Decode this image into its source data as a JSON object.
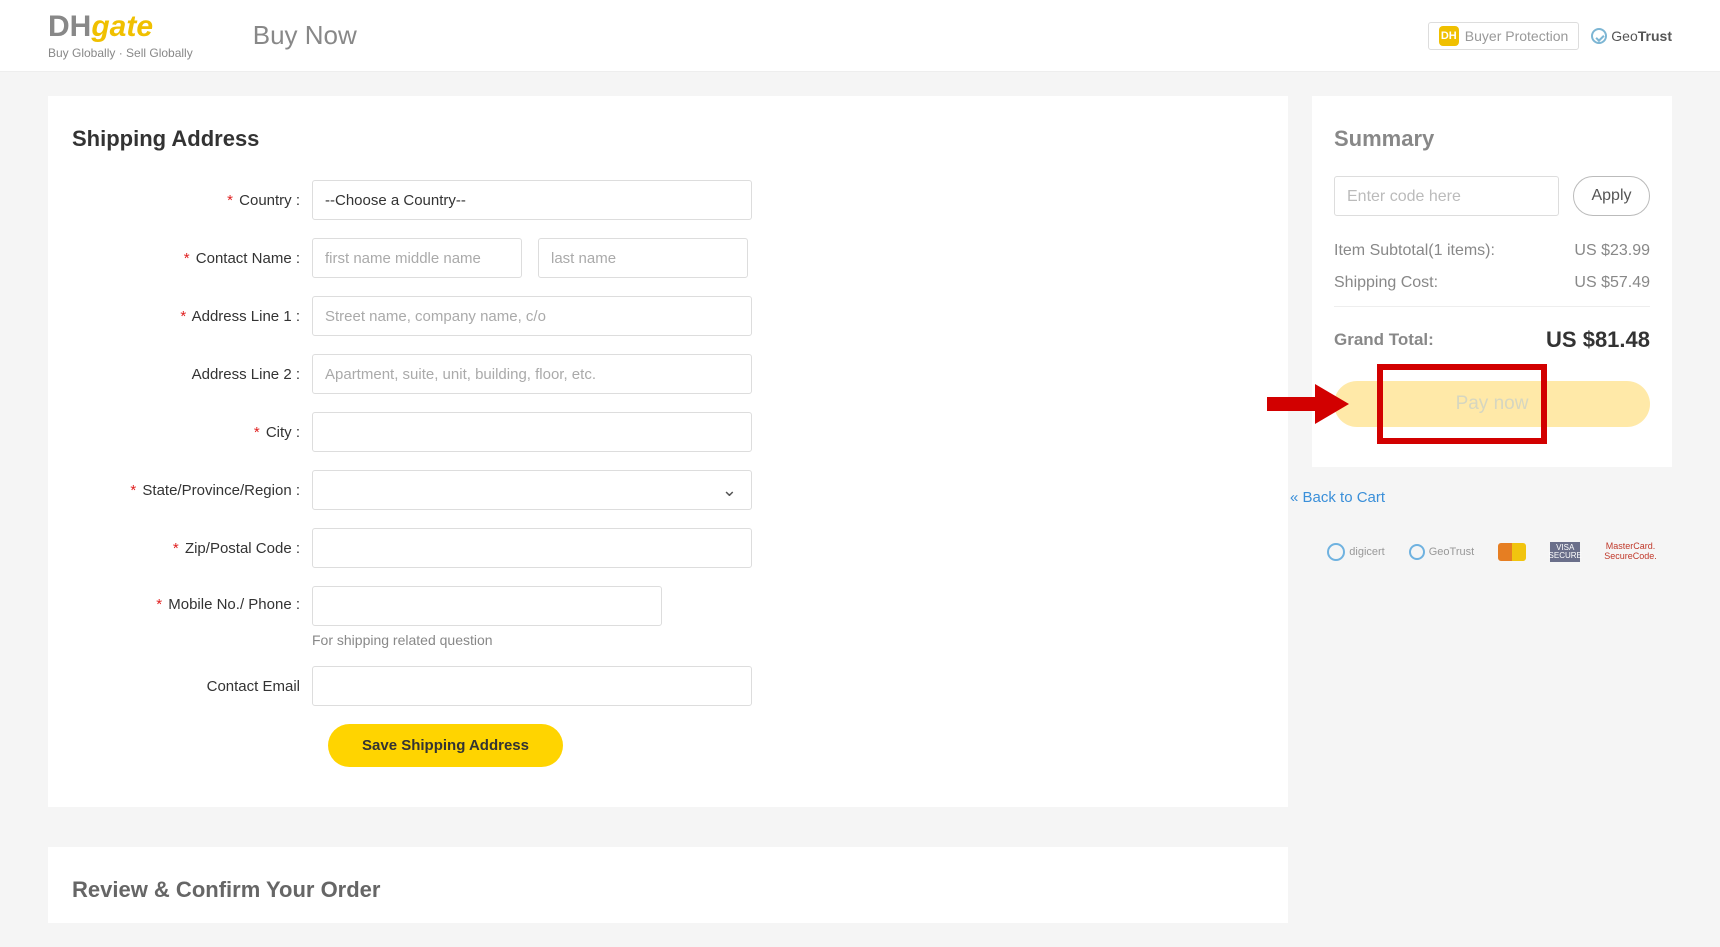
{
  "header": {
    "logo_dh": "DH",
    "logo_gate": "gate",
    "logo_tag": "Buy Globally · Sell Globally",
    "page_title": "Buy Now",
    "buyer_protection": "Buyer Protection",
    "geotrust": "GeoTrust"
  },
  "shipping": {
    "title": "Shipping Address",
    "labels": {
      "country": "Country :",
      "contact_name": "Contact Name :",
      "addr1": "Address Line 1 :",
      "addr2": "Address Line 2 :",
      "city": "City :",
      "region": "State/Province/Region :",
      "zip": "Zip/Postal Code :",
      "phone": "Mobile No./ Phone :",
      "email": "Contact Email"
    },
    "placeholders": {
      "country": "--Choose a Country--",
      "first_name": "first name middle name",
      "last_name": "last name",
      "addr1": "Street name, company name, c/o",
      "addr2": "Apartment, suite, unit, building, floor, etc."
    },
    "phone_help": "For shipping related question",
    "save_button": "Save Shipping Address"
  },
  "review": {
    "title": "Review & Confirm Your Order"
  },
  "summary": {
    "title": "Summary",
    "code_placeholder": "Enter code here",
    "apply": "Apply",
    "subtotal_label": "Item Subtotal(1 items):",
    "subtotal_value": "US $23.99",
    "shipping_label": "Shipping Cost:",
    "shipping_value": "US $57.49",
    "grand_label": "Grand Total:",
    "grand_value": "US $81.48",
    "pay_now": "Pay now",
    "back_to_cart": "« Back to Cart",
    "logos": {
      "digicert": "digicert",
      "geotrust": "GeoTrust",
      "visa_top": "VISA",
      "visa_bot": "SECURE",
      "mcsc_top": "MasterCard.",
      "mcsc_bot": "SecureCode."
    }
  }
}
